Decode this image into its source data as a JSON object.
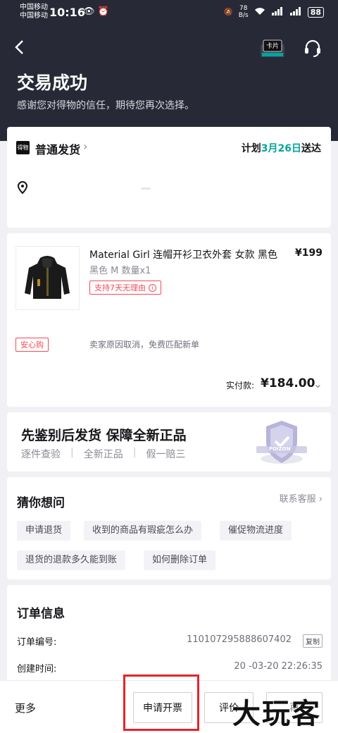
{
  "status": {
    "carrier1": "中国移动",
    "carrier2": "中国移动",
    "time": "10:16",
    "speed": "78",
    "speed_unit": "B/s",
    "battery": "88"
  },
  "header": {
    "card_label": "卡片",
    "title": "交易成功",
    "subtitle": "感谢您对得物的信任，期待您再次选择。"
  },
  "shipping": {
    "logo": "得物",
    "type": "普通发货",
    "plan_prefix": "计划",
    "plan_date": "3月26日",
    "plan_suffix": "送达"
  },
  "product": {
    "name": "Material Girl 连帽开衫卫衣外套 女款 黑色",
    "price": "¥199",
    "spec": "黑色 M 数量x1",
    "return_tag": "支持7天无理由",
    "safe_tag": "安心购",
    "safe_text": "卖家原因取消，免费匹配新单",
    "pay_label": "实付款:",
    "pay_amount": "¥184.00"
  },
  "verify": {
    "title": "先鉴别后发货  保障全新正品",
    "items": [
      "逐件查验",
      "全新正品",
      "假一赔三"
    ],
    "badge_text": "POIZON"
  },
  "guess": {
    "title": "猜你想问",
    "link": "联系客服",
    "chips": [
      "申请退货",
      "收到的商品有瑕疵怎么办",
      "催促物流进度",
      "退货的退款多久能到账",
      "如何删除订单"
    ]
  },
  "order": {
    "title": "订单信息",
    "number_label": "订单编号:",
    "number_value": "110107295888607402",
    "copy": "复制",
    "created_label": "创建时间:",
    "created_value": "20 -03-20 22:26:35"
  },
  "bottom": {
    "more": "更多",
    "invoice": "申请开票",
    "review": "评价",
    "other": "再"
  },
  "watermark": "大玩客",
  "colors": {
    "header_bg": "#272a36",
    "accent": "#01a69d",
    "tag_red": "#ee4c5a",
    "highlight": "#e2262c"
  }
}
